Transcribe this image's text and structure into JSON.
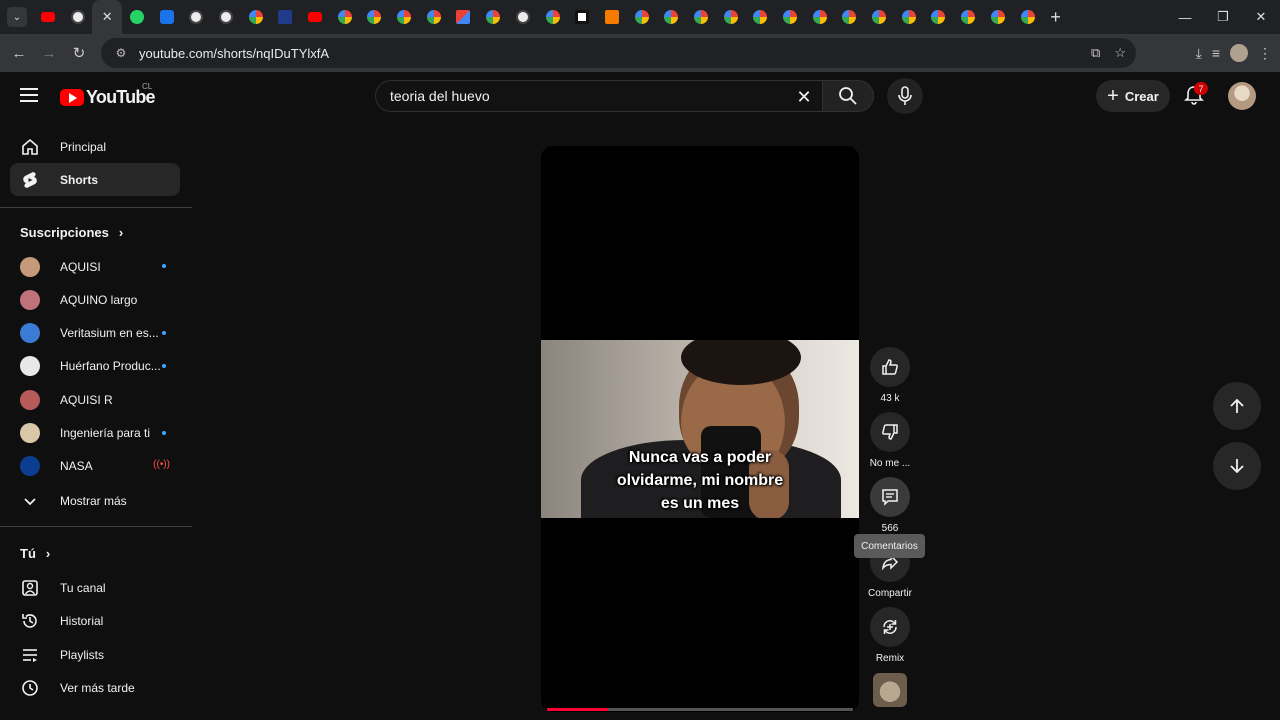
{
  "browser": {
    "tabs": [
      "tabs-menu",
      "youtube",
      "chatgpt",
      "active-close",
      "whatsapp",
      "blue-app",
      "chatgpt",
      "chatgpt",
      "google",
      "tv",
      "youtube",
      "google",
      "google",
      "google",
      "google",
      "gmail",
      "google",
      "chatgpt",
      "google",
      "dark",
      "orange",
      "google",
      "google",
      "google",
      "google",
      "google",
      "google",
      "google",
      "google",
      "google",
      "google",
      "google",
      "google",
      "google",
      "google"
    ],
    "url": "youtube.com/shorts/nqIDuTYlxfA"
  },
  "header": {
    "logo_text": "YouTube",
    "country_code": "CL",
    "search_value": "teoria del huevo",
    "create_label": "Crear",
    "notifications_count": "7"
  },
  "sidebar": {
    "primary": [
      {
        "label": "Principal",
        "icon": "home-icon"
      },
      {
        "label": "Shorts",
        "icon": "shorts-icon",
        "selected": true
      }
    ],
    "subscriptions_title": "Suscripciones",
    "subscriptions": [
      {
        "label": "AQUISI",
        "status": "new",
        "color": "#c49a7a"
      },
      {
        "label": "AQUINO largo",
        "status": "",
        "color": "#c0727a"
      },
      {
        "label": "Veritasium en es...",
        "status": "new",
        "color": "#3b7bd4"
      },
      {
        "label": "Huérfano Produc...",
        "status": "new",
        "color": "#e8e8e8"
      },
      {
        "label": "AQUISI R",
        "status": "",
        "color": "#b75a5a"
      },
      {
        "label": "Ingeniería para ti",
        "status": "new",
        "color": "#d8c8a8"
      },
      {
        "label": "NASA",
        "status": "live",
        "color": "#0b3d91"
      }
    ],
    "show_more": "Mostrar más",
    "you_title": "Tú",
    "you_items": [
      {
        "label": "Tu canal",
        "icon": "channel-icon"
      },
      {
        "label": "Historial",
        "icon": "history-icon"
      },
      {
        "label": "Playlists",
        "icon": "playlists-icon"
      },
      {
        "label": "Ver más tarde",
        "icon": "watch-later-icon"
      }
    ]
  },
  "short": {
    "caption_lines": [
      "Nunca vas a poder",
      "olvidarme, mi nombre",
      "es un mes"
    ],
    "progress": 0.2
  },
  "actions": {
    "like_count": "43 k",
    "dislike_label": "No me ...",
    "comments_count": "566",
    "comments_tooltip": "Comentarios",
    "share_label": "Compartir",
    "remix_label": "Remix"
  },
  "colors": {
    "brand_red": "#ff0000",
    "background": "#0f0f0f",
    "new_dot": "#3ea6ff",
    "live": "#ff4e45",
    "progress": "#ff0033"
  }
}
